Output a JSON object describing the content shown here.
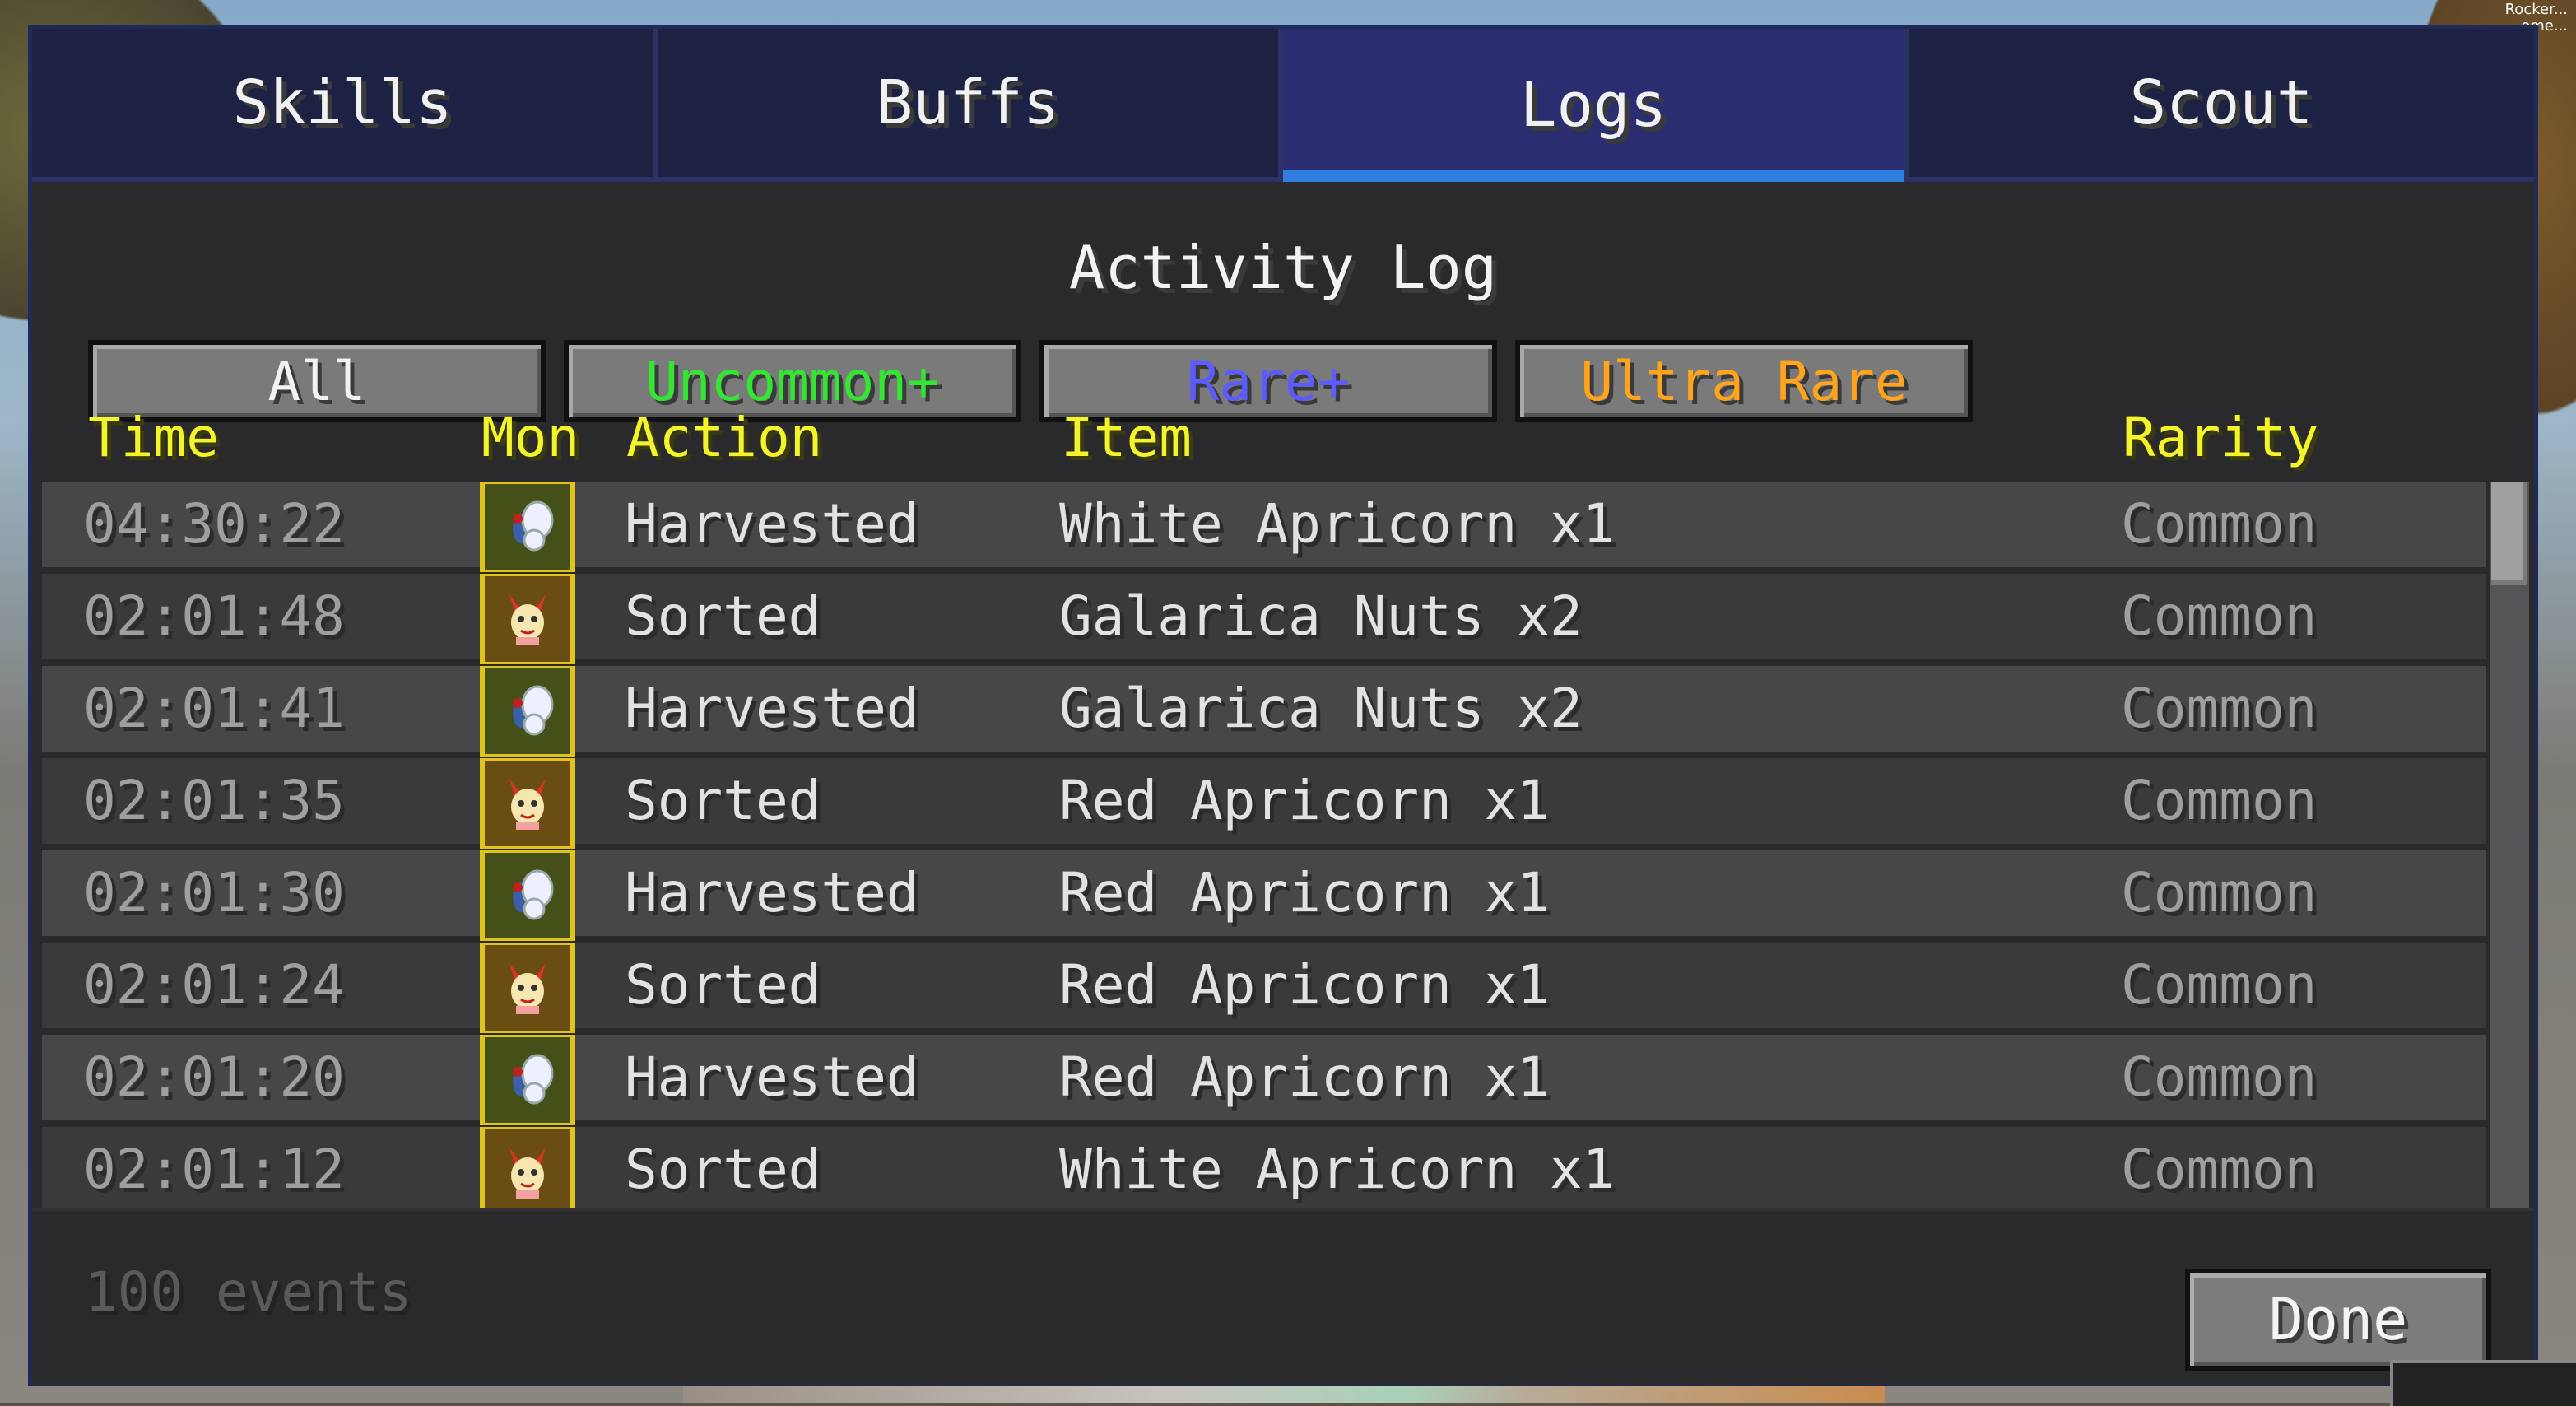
{
  "corner_text": "Rocker...\neme...",
  "tabs": [
    {
      "label": "Skills",
      "active": false
    },
    {
      "label": "Buffs",
      "active": false
    },
    {
      "label": "Logs",
      "active": true
    },
    {
      "label": "Scout",
      "active": false
    }
  ],
  "title": "Activity Log",
  "filters": [
    {
      "label": "All",
      "color": "#f2f2f2"
    },
    {
      "label": "Uncommon+",
      "color": "#32e632"
    },
    {
      "label": "Rare+",
      "color": "#5b5bff"
    },
    {
      "label": "Ultra Rare",
      "color": "#ffa41b"
    }
  ],
  "columns": {
    "time": "Time",
    "mon": "Mon",
    "action": "Action",
    "item": "Item",
    "rarity": "Rarity"
  },
  "rows": [
    {
      "time": "04:30:22",
      "mon_icon": "butterfree-icon",
      "action": "Harvested",
      "item": "White Apricorn x1",
      "rarity": "Common"
    },
    {
      "time": "02:01:48",
      "mon_icon": "combee-icon",
      "action": "Sorted",
      "item": "Galarica Nuts x2",
      "rarity": "Common"
    },
    {
      "time": "02:01:41",
      "mon_icon": "butterfree-icon",
      "action": "Harvested",
      "item": "Galarica Nuts x2",
      "rarity": "Common"
    },
    {
      "time": "02:01:35",
      "mon_icon": "combee-icon",
      "action": "Sorted",
      "item": "Red Apricorn x1",
      "rarity": "Common"
    },
    {
      "time": "02:01:30",
      "mon_icon": "butterfree-icon",
      "action": "Harvested",
      "item": "Red Apricorn x1",
      "rarity": "Common"
    },
    {
      "time": "02:01:24",
      "mon_icon": "combee-icon",
      "action": "Sorted",
      "item": "Red Apricorn x1",
      "rarity": "Common"
    },
    {
      "time": "02:01:20",
      "mon_icon": "butterfree-icon",
      "action": "Harvested",
      "item": "Red Apricorn x1",
      "rarity": "Common"
    },
    {
      "time": "02:01:12",
      "mon_icon": "combee-icon",
      "action": "Sorted",
      "item": "White Apricorn x1",
      "rarity": "Common"
    }
  ],
  "footer": {
    "events": "100 events",
    "done_label": "Done"
  }
}
